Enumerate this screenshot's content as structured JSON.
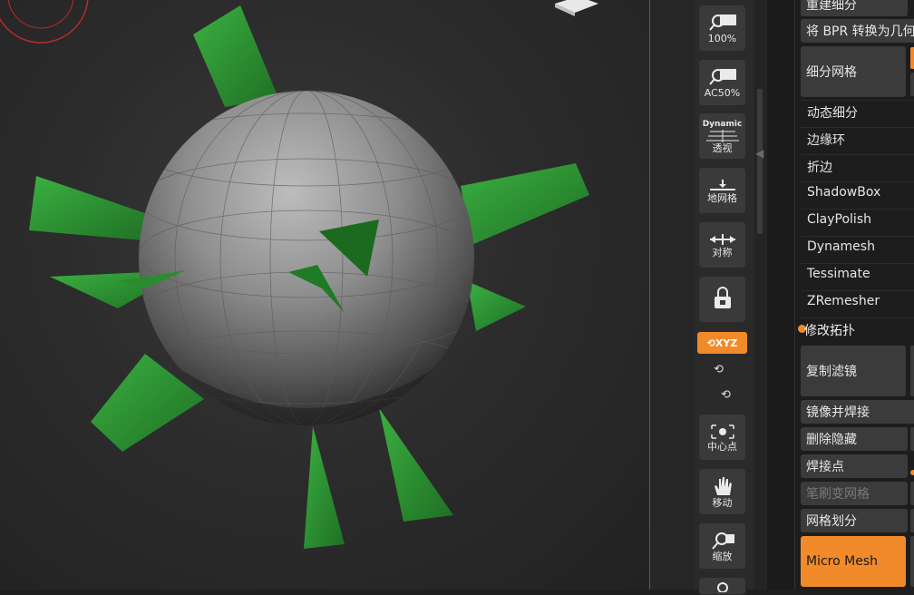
{
  "toolbar": {
    "buttons": [
      {
        "id": "zoom-100",
        "label": "100%",
        "icon": "magnifier-icon"
      },
      {
        "id": "zoom-ac50",
        "label": "AC50%",
        "icon": "magnifier-icon"
      },
      {
        "id": "perspective",
        "title": "Dynamic",
        "label": "透视",
        "icon": "perspective-icon"
      },
      {
        "id": "floor-grid",
        "label": "地网格",
        "icon": "floor-grid-icon"
      },
      {
        "id": "symmetry",
        "label": "对称",
        "icon": "symmetry-icon"
      },
      {
        "id": "lock-camera",
        "label": "",
        "icon": "lock-camera-icon"
      },
      {
        "id": "center",
        "label": "中心点",
        "icon": "center-point-icon"
      },
      {
        "id": "move",
        "label": "移动",
        "icon": "hand-icon"
      },
      {
        "id": "scale",
        "label": "缩放",
        "icon": "magnifier-icon"
      }
    ],
    "xyz_label": "XYZ"
  },
  "palette": {
    "rebuild_subdiv": "重建细分",
    "bpr_to_geo": "将 BPR 转换为几何",
    "subdivide_mesh": "细分网格",
    "dynamic_subdiv": "动态细分",
    "edge_loop": "边缘环",
    "crease": "折边",
    "shadowbox": "ShadowBox",
    "claypolish": "ClayPolish",
    "dynamesh": "Dynamesh",
    "tessimate": "Tessimate",
    "zremesher": "ZRemesher",
    "modify_topology": "修改拓扑",
    "copy_filter": "复制滤镜",
    "mirror_weld": "镜像并焊接",
    "del_hidden": "删除隐藏",
    "weld_points": "焊接点",
    "brush_to_mesh": "笔刷变网格",
    "grid_divide": "网格划分",
    "micro_mesh": "Micro Mesh"
  },
  "colors": {
    "accent": "#f08a2a",
    "panel_bg": "#1d1d1d",
    "button_bg": "#3b3b3b",
    "sphere": "#8a8a8a",
    "leaves": "#2f9a35"
  }
}
